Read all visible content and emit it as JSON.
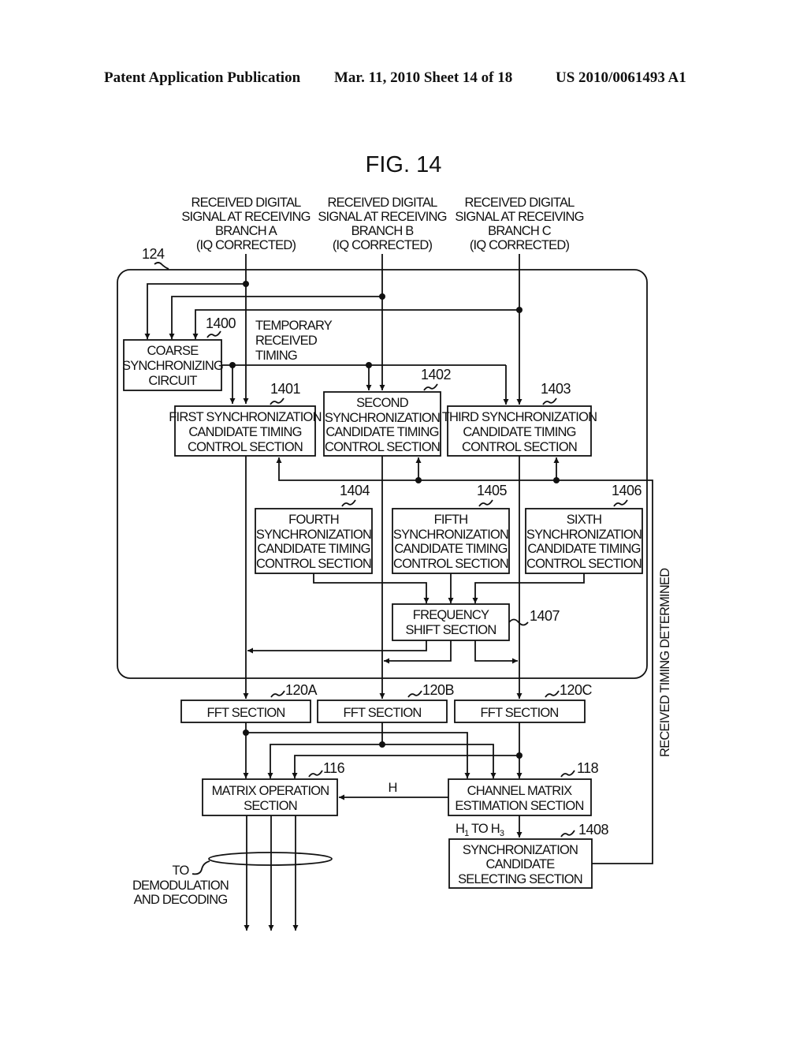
{
  "header": {
    "publication": "Patent Application Publication",
    "date_sheet": "Mar. 11, 2010  Sheet 14 of 18",
    "patent_number": "US 2010/0061493 A1"
  },
  "figure": {
    "title": "FIG. 14",
    "container_ref": "124",
    "inputs": [
      {
        "lines": [
          "RECEIVED DIGITAL",
          "SIGNAL AT RECEIVING",
          "BRANCH A",
          "(IQ CORRECTED)"
        ]
      },
      {
        "lines": [
          "RECEIVED DIGITAL",
          "SIGNAL AT RECEIVING",
          "BRANCH B",
          "(IQ CORRECTED)"
        ]
      },
      {
        "lines": [
          "RECEIVED DIGITAL",
          "SIGNAL AT RECEIVING",
          "BRANCH C",
          "(IQ CORRECTED)"
        ]
      }
    ],
    "blocks": {
      "coarse": {
        "ref": "1400",
        "lines": [
          "COARSE",
          "SYNCHRONIZING",
          "CIRCUIT"
        ]
      },
      "first": {
        "ref": "1401",
        "lines": [
          "FIRST SYNCHRONIZATION",
          "CANDIDATE TIMING",
          "CONTROL SECTION"
        ]
      },
      "second": {
        "ref": "1402",
        "lines": [
          "SECOND",
          "SYNCHRONIZATION",
          "CANDIDATE TIMING",
          "CONTROL SECTION"
        ]
      },
      "third": {
        "ref": "1403",
        "lines": [
          "THIRD SYNCHRONIZATION",
          "CANDIDATE TIMING",
          "CONTROL SECTION"
        ]
      },
      "fourth": {
        "ref": "1404",
        "lines": [
          "FOURTH",
          "SYNCHRONIZATION",
          "CANDIDATE TIMING",
          "CONTROL SECTION"
        ]
      },
      "fifth": {
        "ref": "1405",
        "lines": [
          "FIFTH",
          "SYNCHRONIZATION",
          "CANDIDATE TIMING",
          "CONTROL SECTION"
        ]
      },
      "sixth": {
        "ref": "1406",
        "lines": [
          "SIXTH",
          "SYNCHRONIZATION",
          "CANDIDATE TIMING",
          "CONTROL SECTION"
        ]
      },
      "freq": {
        "ref": "1407",
        "lines": [
          "FREQUENCY",
          "SHIFT SECTION"
        ]
      },
      "fftA": {
        "ref": "120A",
        "lines": [
          "FFT SECTION"
        ]
      },
      "fftB": {
        "ref": "120B",
        "lines": [
          "FFT SECTION"
        ]
      },
      "fftC": {
        "ref": "120C",
        "lines": [
          "FFT SECTION"
        ]
      },
      "matrix": {
        "ref": "116",
        "lines": [
          "MATRIX OPERATION",
          "SECTION"
        ]
      },
      "channel": {
        "ref": "118",
        "lines": [
          "CHANNEL MATRIX",
          "ESTIMATION SECTION"
        ]
      },
      "selector": {
        "ref": "1408",
        "lines": [
          "SYNCHRONIZATION",
          "CANDIDATE",
          "SELECTING SECTION"
        ]
      }
    },
    "annotations": {
      "temporary_timing": [
        "TEMPORARY",
        "RECEIVED",
        "TIMING"
      ],
      "h_signal": "H",
      "h_range_main": "H",
      "h_range_sub1": "1",
      "h_range_to": " TO H",
      "h_range_sub3": "3",
      "received_timing": "RECEIVED TIMING DETERMINED",
      "output_dest": [
        "TO",
        "DEMODULATION",
        "AND DECODING"
      ]
    }
  }
}
